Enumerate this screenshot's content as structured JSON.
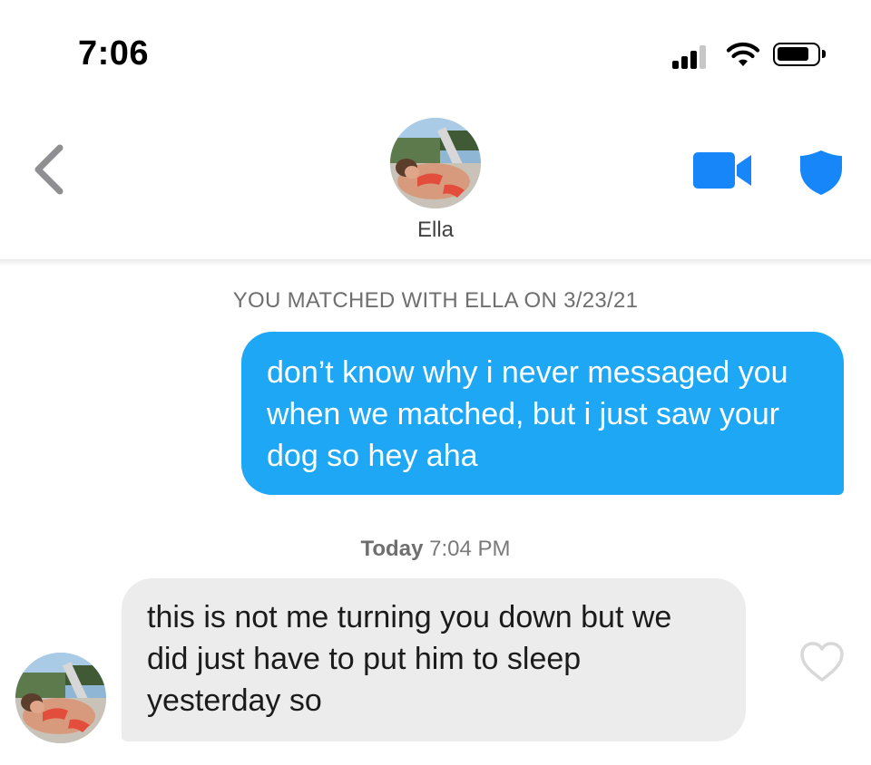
{
  "status_bar": {
    "time": "7:06",
    "signal_icon": "cellular-signal-icon",
    "wifi_icon": "wifi-icon",
    "battery_icon": "battery-icon"
  },
  "header": {
    "back_icon": "chevron-left-icon",
    "contact_name": "Ella",
    "video_icon": "video-camera-icon",
    "safety_icon": "shield-icon"
  },
  "conversation": {
    "match_note": "YOU MATCHED WITH ELLA ON 3/23/21",
    "messages": [
      {
        "direction": "sent",
        "text": "don’t know why i never messaged you when we matched, but i just saw your dog so hey aha"
      },
      {
        "direction": "received",
        "text": "this is not me turning you down but we did just have to put him to sleep yesterday so"
      }
    ],
    "timestamp": {
      "day": "Today",
      "time": "7:04 PM"
    },
    "like_icon": "heart-outline-icon"
  },
  "colors": {
    "accent_blue": "#1EA7F5",
    "header_icon_blue": "#1786F8",
    "received_bubble": "#ECECEC",
    "back_chevron": "#8E8E93",
    "heart_outline": "#D8D8D8"
  }
}
